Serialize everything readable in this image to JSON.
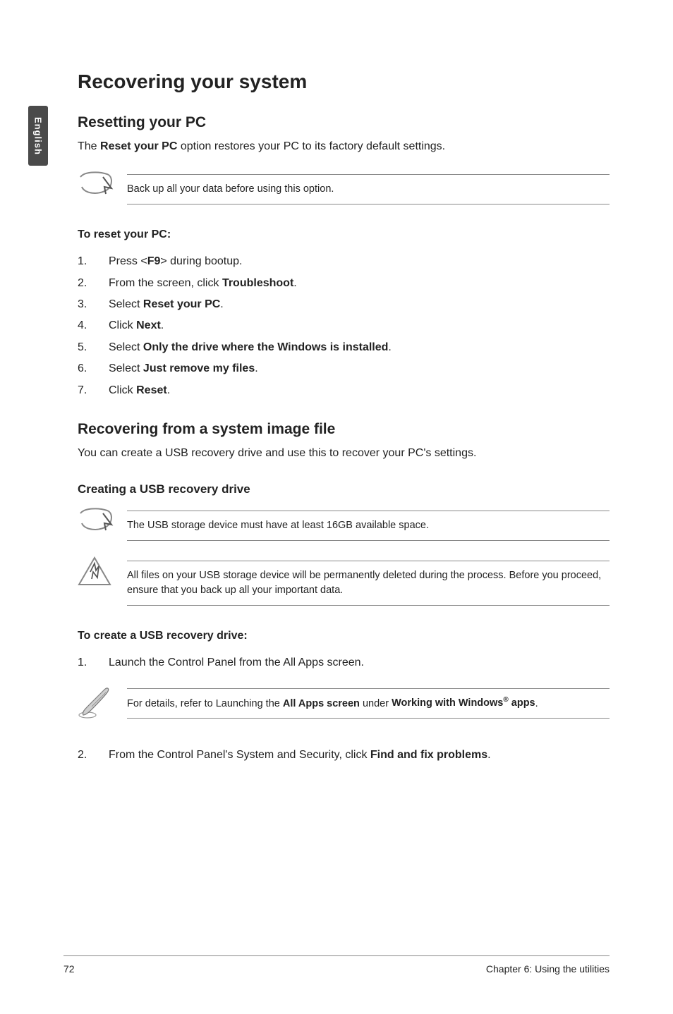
{
  "side_tab": "English",
  "h1": "Recovering your system",
  "reset": {
    "title": "Resetting your PC",
    "intro_parts": [
      "The ",
      "Reset your PC",
      " option restores your PC to its factory default settings."
    ],
    "note": "Back up all your data before using this option.",
    "steps_heading": "To reset your PC:",
    "steps": [
      {
        "n": "1.",
        "parts": [
          "Press <",
          "F9",
          "> during bootup."
        ]
      },
      {
        "n": "2.",
        "parts": [
          "From the screen, click ",
          "Troubleshoot",
          "."
        ]
      },
      {
        "n": "3.",
        "parts": [
          "Select ",
          "Reset your PC",
          "."
        ]
      },
      {
        "n": "4.",
        "parts": [
          "Click ",
          "Next",
          "."
        ]
      },
      {
        "n": "5.",
        "parts": [
          "Select ",
          "Only the drive where the Windows is installed",
          "."
        ]
      },
      {
        "n": "6.",
        "parts": [
          "Select ",
          "Just remove my files",
          "."
        ]
      },
      {
        "n": "7.",
        "parts": [
          "Click ",
          "Reset",
          "."
        ]
      }
    ]
  },
  "recover_img": {
    "title": "Recovering from a system image file",
    "intro": "You can create a USB recovery drive and use this to recover your PC's settings.",
    "sub": "Creating a USB recovery drive",
    "note1": "The USB storage device must have at least 16GB available space.",
    "note2": "All files on your USB storage device will be permanently deleted during the process. Before you proceed, ensure that you back up all your important data.",
    "steps_heading": "To create a USB recovery drive:",
    "step1": {
      "n": "1.",
      "text": "Launch the Control Panel from the All Apps screen."
    },
    "note3_parts": [
      "For details, refer to Launching the ",
      "All Apps screen",
      " under ",
      "Working with Windows",
      "®",
      " apps",
      "."
    ],
    "step2": {
      "n": "2.",
      "parts": [
        "From the Control Panel's System and Security, click ",
        "Find and fix problems",
        "."
      ]
    }
  },
  "footer": {
    "page": "72",
    "chapter": "Chapter 6: Using the utilities"
  }
}
